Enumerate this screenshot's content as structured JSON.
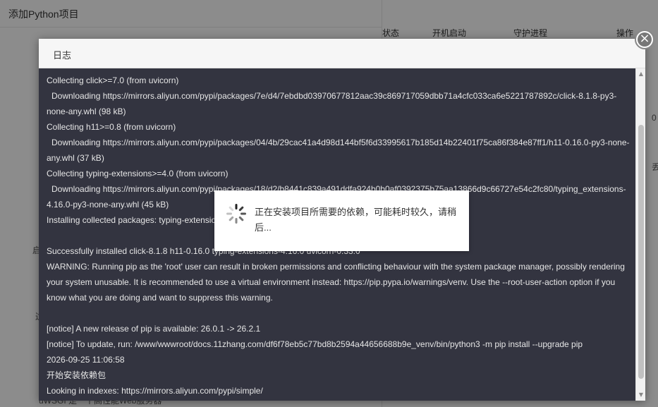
{
  "background": {
    "left_title": "添加Python项目",
    "stray_left": [
      "启",
      "过",
      "uWSGI 是一个高性能Web服务器"
    ],
    "table_columns": [
      "状态",
      "开机启动",
      "守护进程",
      "操作"
    ],
    "stray_right": [
      "0",
      "丢"
    ]
  },
  "dialog": {
    "title": "日志",
    "close_label": "×"
  },
  "log": {
    "lines": [
      "Collecting click>=7.0 (from uvicorn)",
      "Downloading https://mirrors.aliyun.com/pypi/packages/7e/d4/7ebdbd03970677812aac39c869717059dbb71a4cfc033ca6e5221787892c/click-8.1.8-py3-",
      "none-any.whl (98 kB)",
      "Collecting h11>=0.8 (from uvicorn)",
      "Downloading https://mirrors.aliyun.com/pypi/packages/04/4b/29cac41a4d98d144bf5f6d33995617b185d14b22401f75ca86f384e87ff1/h11-0.16.0-py3-none-",
      "any.whl (37 kB)",
      "Collecting typing-extensions>=4.0 (from uvicorn)",
      "Downloading https://mirrors.aliyun.com/pypi/packages/18/d2/b8441c839a491ddfa924b0b0af0392375b75aa13866d9c66727e54c2fc80/typing_extensions-",
      "4.16.0-py3-none-any.whl (45 kB)",
      "Installing collected packages: typing-extensions, h11, click, uvicorn",
      "",
      "Successfully installed click-8.1.8 h11-0.16.0 typing-extensions-4.16.0 uvicorn-0.33.0",
      "WARNING: Running pip as the 'root' user can result in broken permissions and conflicting behaviour with the system package manager, possibly rendering",
      "your system unusable. It is recommended to use a virtual environment instead: https://pip.pypa.io/warnings/venv. Use the --root-user-action option if you",
      "know what you are doing and want to suppress this warning.",
      "",
      "[notice] A new release of pip is available: 26.0.1 -> 26.2.1",
      "[notice] To update, run: /www/wwwroot/docs.11zhang.com/df6f78eb5c77bd8b2594a44656688b9e_venv/bin/python3 -m pip install --upgrade pip",
      "2026-09-25 11:06:58",
      "开始安装依赖包",
      "Looking in indexes: https://mirrors.aliyun.com/pypi/simple/"
    ],
    "indented": [
      1,
      4,
      7
    ]
  },
  "scrollbar": {
    "up_icon": "▲",
    "down_icon": "▼"
  },
  "loading": {
    "message": "正在安装项目所需要的依赖，可能耗时较久，请稍后..."
  }
}
